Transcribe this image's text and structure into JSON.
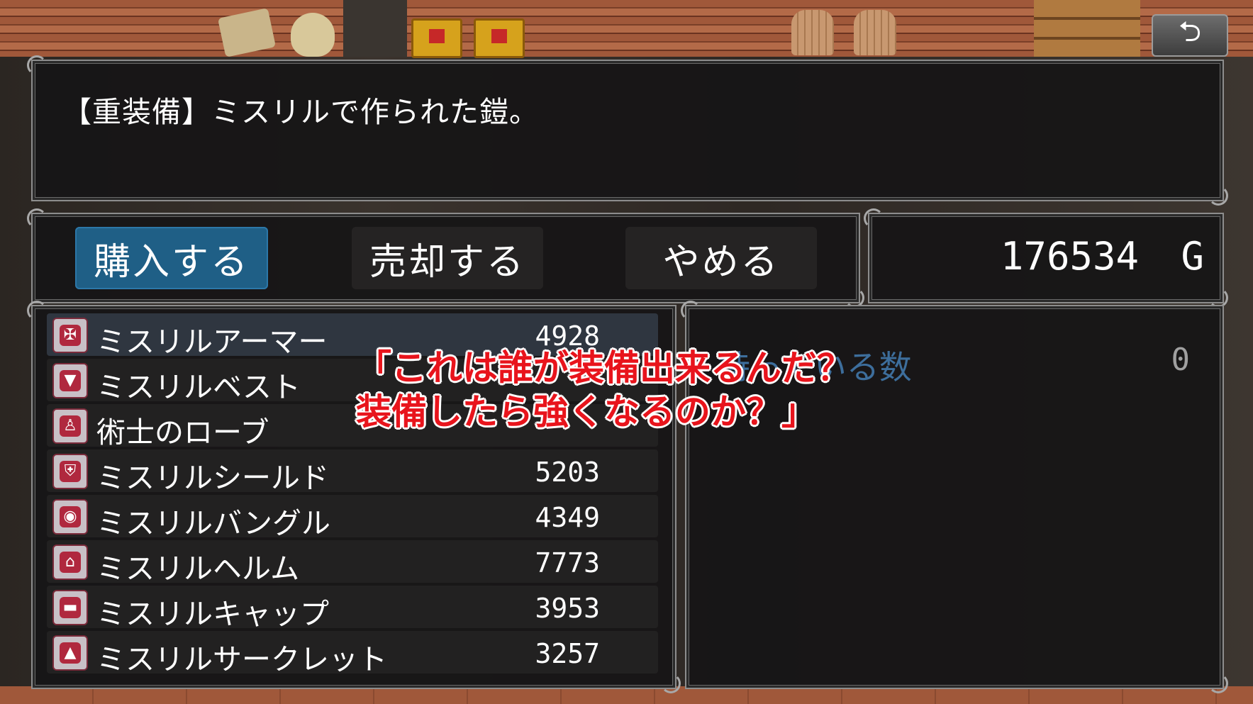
{
  "description": "【重装備】ミスリルで作られた鎧。",
  "commands": {
    "buy_label": "購入する",
    "sell_label": "売却する",
    "quit_label": "やめる"
  },
  "gold": {
    "amount": "176534",
    "unit": "G"
  },
  "items": [
    {
      "name": "ミスリルアーマー",
      "price": "4928",
      "icon": "armor-icon",
      "glyph": "✠"
    },
    {
      "name": "ミスリルベスト",
      "price": "",
      "icon": "vest-icon",
      "glyph": "▼"
    },
    {
      "name": "術士のローブ",
      "price": "",
      "icon": "robe-icon",
      "glyph": "♙"
    },
    {
      "name": "ミスリルシールド",
      "price": "5203",
      "icon": "shield-icon",
      "glyph": "⛨"
    },
    {
      "name": "ミスリルバングル",
      "price": "4349",
      "icon": "bangle-icon",
      "glyph": "◉"
    },
    {
      "name": "ミスリルヘルム",
      "price": "7773",
      "icon": "helm-icon",
      "glyph": "⌂"
    },
    {
      "name": "ミスリルキャップ",
      "price": "3953",
      "icon": "cap-icon",
      "glyph": "▬"
    },
    {
      "name": "ミスリルサークレット",
      "price": "3257",
      "icon": "circlet-icon",
      "glyph": "▲"
    }
  ],
  "owned": {
    "label": "持っている数",
    "value": "0"
  },
  "back_button": {
    "icon": "back-arrow-icon",
    "glyph": "⮌"
  },
  "overlay": {
    "line1": "「これは誰が装備出来るんだ？",
    "line2": "装備したら強くなるのか？」"
  }
}
